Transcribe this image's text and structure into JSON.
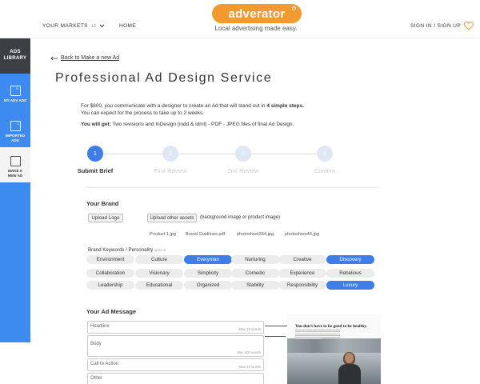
{
  "header": {
    "markets_label": "YOUR MARKETS",
    "markets_count": "13",
    "home_label": "HOME",
    "logo_text": "adverator",
    "tagline": "Local advertising made easy.",
    "signin_label": "SIGN IN / SIGN UP",
    "heart_icon": "heart-icon",
    "accent_color": "#f39a2e"
  },
  "sidebar": {
    "title_line1": "ADS",
    "title_line2": "LIBRARY",
    "items": [
      {
        "line1": "MY ADV ADS",
        "line2": "",
        "badge": "11",
        "icon": "my-ads-icon"
      },
      {
        "line1": "IMPORTED",
        "line2": "ADS",
        "badge": "3",
        "icon": "imported-ads-icon"
      },
      {
        "line1": "MAKE A",
        "line2": "NEW AD",
        "badge": "",
        "icon": "new-ad-icon"
      }
    ],
    "color": "#3d8af0"
  },
  "back_link": "Back to Make a new Ad",
  "page_title": "Professional Ad Design Service",
  "intro": {
    "text_before": "For $800, you communicate with a designer to create an Ad that will stand out in ",
    "bold": "4 simple steps.",
    "line2": "You can expect for the process to take up to 2 weeks.",
    "get_label": "You will get:",
    "get_text": " Two revisions and InDesign (indd & idml) - PDF - JPEG  files of final Ad Design."
  },
  "steps": [
    {
      "num": "1",
      "label": "Submit Brief",
      "active": true
    },
    {
      "num": "2",
      "label": "First Review",
      "active": false
    },
    {
      "num": "3",
      "label": "2nd Review",
      "active": false
    },
    {
      "num": "4",
      "label": "Confirm",
      "active": false
    }
  ],
  "brand": {
    "heading": "Your Brand",
    "upload_logo": "Upload Logo",
    "upload_other": "Upload other assets",
    "upload_note": "(background image or product image)",
    "files": [
      "Product 1.jpg",
      "Brand Guidlines.pdf",
      "photoshoot364.jpg",
      "photoshoot44.jpg"
    ],
    "keywords_label": "Brand Keywords / Personality",
    "keywords_hint": "up to 3",
    "keywords": [
      {
        "label": "Environment",
        "selected": false
      },
      {
        "label": "Culture",
        "selected": false
      },
      {
        "label": "Everyman",
        "selected": true
      },
      {
        "label": "Nurturing",
        "selected": false
      },
      {
        "label": "Creative",
        "selected": false
      },
      {
        "label": "Discovery",
        "selected": true
      },
      {
        "label": "Collaboration",
        "selected": false
      },
      {
        "label": "Visionary",
        "selected": false
      },
      {
        "label": "Simplicity",
        "selected": false
      },
      {
        "label": "Comedic",
        "selected": false
      },
      {
        "label": "Experience",
        "selected": false
      },
      {
        "label": "Rebelious",
        "selected": false
      },
      {
        "label": "Leadership",
        "selected": false
      },
      {
        "label": "Educational",
        "selected": false
      },
      {
        "label": "Organized",
        "selected": false
      },
      {
        "label": "Stability",
        "selected": false
      },
      {
        "label": "Responsibility",
        "selected": false
      },
      {
        "label": "Luxury",
        "selected": true
      }
    ]
  },
  "message": {
    "heading": "Your Ad Message",
    "fields": [
      {
        "label": "Headline",
        "max": "Max 10 words"
      },
      {
        "label": "Body",
        "max": "Max 400 words"
      },
      {
        "label": "Call to Action",
        "max": "Max 10 words"
      },
      {
        "label": "Other",
        "max": ""
      }
    ]
  },
  "preview": {
    "headline": "You don't have to be good to be healthy."
  }
}
